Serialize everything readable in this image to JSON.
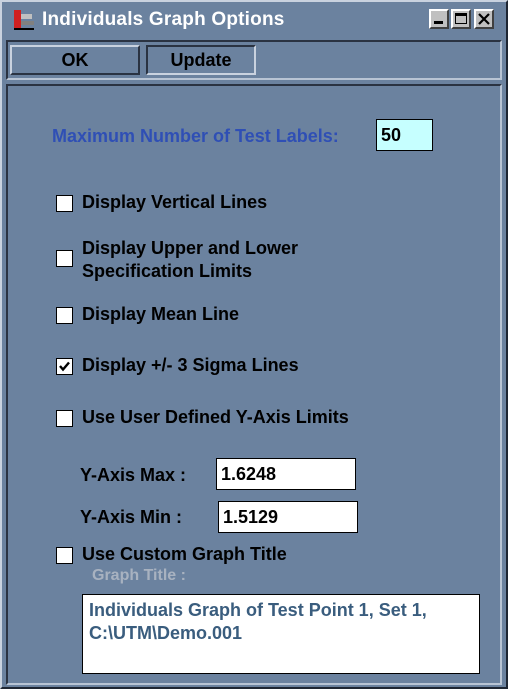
{
  "window": {
    "title": "Individuals Graph Options",
    "icon": "app-icon",
    "controls": [
      "minimize-icon",
      "maximize-icon",
      "close-icon"
    ]
  },
  "toolbar": {
    "ok_label": "OK",
    "update_label": "Update"
  },
  "options": {
    "max_test_labels_label": "Maximum Number of Test Labels:",
    "max_test_labels_value": "50",
    "display_vertical_lines": {
      "label": "Display Vertical Lines",
      "checked": false
    },
    "display_spec_limits": {
      "label_line1": "Display Upper and Lower",
      "label_line2": "Specification Limits",
      "checked": false
    },
    "display_mean_line": {
      "label": "Display Mean Line",
      "checked": false
    },
    "display_sigma_lines": {
      "label": "Display +/- 3 Sigma Lines",
      "checked": true
    },
    "use_user_y_limits": {
      "label": "Use User Defined Y-Axis Limits",
      "checked": false
    },
    "y_axis_max_label": "Y-Axis Max :",
    "y_axis_max_value": "1.6248",
    "y_axis_min_label": "Y-Axis Min :",
    "y_axis_min_value": "1.5129",
    "use_custom_title": {
      "label": "Use Custom Graph Title",
      "checked": false
    },
    "graph_title_label": "Graph Title :",
    "graph_title_value": "Individuals Graph of Test Point 1, Set 1,\nC:\\UTM\\Demo.001"
  },
  "colors": {
    "window_bg": "#6b829f",
    "label_blue": "#2f4fb5",
    "entry_cyan": "#c6ffff",
    "disabled_text": "#a8b2c0"
  }
}
